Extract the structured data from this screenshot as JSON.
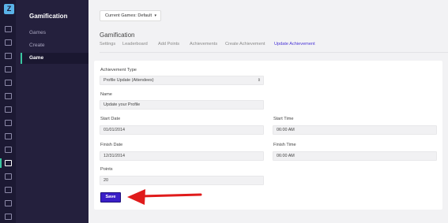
{
  "rail": {
    "logo_letter": "Z"
  },
  "sidebar": {
    "title": "Gamification",
    "items": [
      {
        "label": "Games"
      },
      {
        "label": "Create"
      },
      {
        "label": "Game"
      }
    ]
  },
  "header": {
    "games_dropdown": "Current Games: Default"
  },
  "page": {
    "title": "Gamification",
    "tabs": [
      {
        "label": "Settings"
      },
      {
        "label": "Leaderboard"
      },
      {
        "label": "Add Points"
      },
      {
        "label": "Achievements"
      },
      {
        "label": "Create Achievement"
      },
      {
        "label": "Update Achievement"
      }
    ]
  },
  "form": {
    "achievement_type_label": "Achievement Type",
    "achievement_type_value": "Profile Update (Attendees)",
    "name_label": "Name",
    "name_value": "Update your Profile",
    "start_date_label": "Start Date",
    "start_date_value": "01/01/2014",
    "start_time_label": "Start Time",
    "start_time_value": "06:00 AM",
    "finish_date_label": "Finish Date",
    "finish_date_value": "12/31/2014",
    "finish_time_label": "Finish Time",
    "finish_time_value": "06:00 AM",
    "points_label": "Points",
    "points_value": "20",
    "save_label": "Save"
  },
  "colors": {
    "accent": "#4a35d6",
    "save_button": "#3a1fc7",
    "annotation_arrow": "#e01b1b",
    "sidebar_active": "#3ac6a0"
  }
}
